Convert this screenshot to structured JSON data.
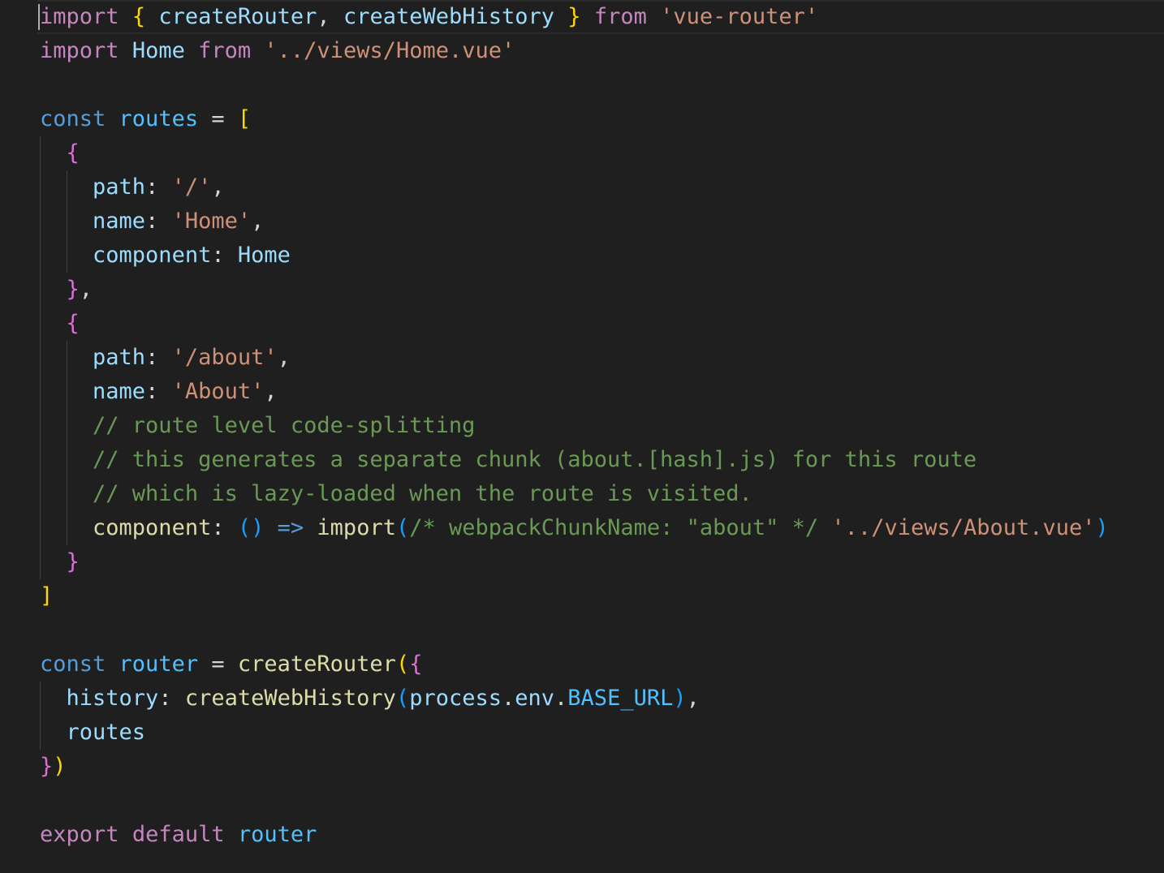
{
  "editor": {
    "language": "javascript",
    "theme_colors": {
      "background": "#1f1f1f",
      "keyword_control": "#c586c0",
      "keyword_storage": "#569cd6",
      "variable": "#9cdcfe",
      "constant": "#4fc1ff",
      "function": "#dcdcaa",
      "string": "#ce9178",
      "comment": "#6a9955",
      "punctuation": "#d4d4d4",
      "bracket_level_1": "#ffd700",
      "bracket_level_2": "#da70d6",
      "bracket_level_3": "#179fff"
    },
    "lines": [
      {
        "tokens": [
          {
            "t": "import",
            "c": "kw"
          },
          {
            "t": " ",
            "c": "pun"
          },
          {
            "t": "{",
            "c": "b1"
          },
          {
            "t": " ",
            "c": "pun"
          },
          {
            "t": "createRouter",
            "c": "var"
          },
          {
            "t": ", ",
            "c": "pun"
          },
          {
            "t": "createWebHistory",
            "c": "var"
          },
          {
            "t": " ",
            "c": "pun"
          },
          {
            "t": "}",
            "c": "b1"
          },
          {
            "t": " ",
            "c": "pun"
          },
          {
            "t": "from",
            "c": "kw"
          },
          {
            "t": " ",
            "c": "pun"
          },
          {
            "t": "'vue-router'",
            "c": "str"
          }
        ]
      },
      {
        "tokens": [
          {
            "t": "import",
            "c": "kw"
          },
          {
            "t": " ",
            "c": "pun"
          },
          {
            "t": "Home",
            "c": "var"
          },
          {
            "t": " ",
            "c": "pun"
          },
          {
            "t": "from",
            "c": "kw"
          },
          {
            "t": " ",
            "c": "pun"
          },
          {
            "t": "'../views/Home.vue'",
            "c": "str"
          }
        ]
      },
      {
        "tokens": []
      },
      {
        "tokens": [
          {
            "t": "const",
            "c": "kw2"
          },
          {
            "t": " ",
            "c": "pun"
          },
          {
            "t": "routes",
            "c": "const"
          },
          {
            "t": " = ",
            "c": "pun"
          },
          {
            "t": "[",
            "c": "b1"
          }
        ]
      },
      {
        "tokens": [
          {
            "t": "  ",
            "c": "pun"
          },
          {
            "t": "{",
            "c": "b2"
          }
        ]
      },
      {
        "tokens": [
          {
            "t": "    ",
            "c": "pun"
          },
          {
            "t": "path",
            "c": "var"
          },
          {
            "t": ": ",
            "c": "pun"
          },
          {
            "t": "'/'",
            "c": "str"
          },
          {
            "t": ",",
            "c": "pun"
          }
        ]
      },
      {
        "tokens": [
          {
            "t": "    ",
            "c": "pun"
          },
          {
            "t": "name",
            "c": "var"
          },
          {
            "t": ": ",
            "c": "pun"
          },
          {
            "t": "'Home'",
            "c": "str"
          },
          {
            "t": ",",
            "c": "pun"
          }
        ]
      },
      {
        "tokens": [
          {
            "t": "    ",
            "c": "pun"
          },
          {
            "t": "component",
            "c": "var"
          },
          {
            "t": ": ",
            "c": "pun"
          },
          {
            "t": "Home",
            "c": "var"
          }
        ]
      },
      {
        "tokens": [
          {
            "t": "  ",
            "c": "pun"
          },
          {
            "t": "}",
            "c": "b2"
          },
          {
            "t": ",",
            "c": "pun"
          }
        ]
      },
      {
        "tokens": [
          {
            "t": "  ",
            "c": "pun"
          },
          {
            "t": "{",
            "c": "b2"
          }
        ]
      },
      {
        "tokens": [
          {
            "t": "    ",
            "c": "pun"
          },
          {
            "t": "path",
            "c": "var"
          },
          {
            "t": ": ",
            "c": "pun"
          },
          {
            "t": "'/about'",
            "c": "str"
          },
          {
            "t": ",",
            "c": "pun"
          }
        ]
      },
      {
        "tokens": [
          {
            "t": "    ",
            "c": "pun"
          },
          {
            "t": "name",
            "c": "var"
          },
          {
            "t": ": ",
            "c": "pun"
          },
          {
            "t": "'About'",
            "c": "str"
          },
          {
            "t": ",",
            "c": "pun"
          }
        ]
      },
      {
        "tokens": [
          {
            "t": "    ",
            "c": "pun"
          },
          {
            "t": "// route level code-splitting",
            "c": "cmt"
          }
        ]
      },
      {
        "tokens": [
          {
            "t": "    ",
            "c": "pun"
          },
          {
            "t": "// this generates a separate chunk (about.[hash].js) for this route",
            "c": "cmt"
          }
        ]
      },
      {
        "tokens": [
          {
            "t": "    ",
            "c": "pun"
          },
          {
            "t": "// which is lazy-loaded when the route is visited.",
            "c": "cmt"
          }
        ]
      },
      {
        "tokens": [
          {
            "t": "    ",
            "c": "pun"
          },
          {
            "t": "component",
            "c": "fn"
          },
          {
            "t": ": ",
            "c": "pun"
          },
          {
            "t": "()",
            "c": "b3"
          },
          {
            "t": " ",
            "c": "pun"
          },
          {
            "t": "=>",
            "c": "kw2"
          },
          {
            "t": " ",
            "c": "pun"
          },
          {
            "t": "import",
            "c": "fn"
          },
          {
            "t": "(",
            "c": "b3"
          },
          {
            "t": "/* webpackChunkName: \"about\" */",
            "c": "cmt"
          },
          {
            "t": " ",
            "c": "pun"
          },
          {
            "t": "'../views/About.vue'",
            "c": "str"
          },
          {
            "t": ")",
            "c": "b3"
          }
        ]
      },
      {
        "tokens": [
          {
            "t": "  ",
            "c": "pun"
          },
          {
            "t": "}",
            "c": "b2"
          }
        ]
      },
      {
        "tokens": [
          {
            "t": "]",
            "c": "b1"
          }
        ]
      },
      {
        "tokens": []
      },
      {
        "tokens": [
          {
            "t": "const",
            "c": "kw2"
          },
          {
            "t": " ",
            "c": "pun"
          },
          {
            "t": "router",
            "c": "const"
          },
          {
            "t": " = ",
            "c": "pun"
          },
          {
            "t": "createRouter",
            "c": "fn"
          },
          {
            "t": "(",
            "c": "b1"
          },
          {
            "t": "{",
            "c": "b2"
          }
        ]
      },
      {
        "tokens": [
          {
            "t": "  ",
            "c": "pun"
          },
          {
            "t": "history",
            "c": "var"
          },
          {
            "t": ": ",
            "c": "pun"
          },
          {
            "t": "createWebHistory",
            "c": "fn"
          },
          {
            "t": "(",
            "c": "b3"
          },
          {
            "t": "process",
            "c": "var"
          },
          {
            "t": ".",
            "c": "pun"
          },
          {
            "t": "env",
            "c": "var"
          },
          {
            "t": ".",
            "c": "pun"
          },
          {
            "t": "BASE_URL",
            "c": "const"
          },
          {
            "t": ")",
            "c": "b3"
          },
          {
            "t": ",",
            "c": "pun"
          }
        ]
      },
      {
        "tokens": [
          {
            "t": "  ",
            "c": "pun"
          },
          {
            "t": "routes",
            "c": "var"
          }
        ]
      },
      {
        "tokens": [
          {
            "t": "}",
            "c": "b2"
          },
          {
            "t": ")",
            "c": "b1"
          }
        ]
      },
      {
        "tokens": []
      },
      {
        "tokens": [
          {
            "t": "export",
            "c": "kw"
          },
          {
            "t": " ",
            "c": "pun"
          },
          {
            "t": "default",
            "c": "kw"
          },
          {
            "t": " ",
            "c": "pun"
          },
          {
            "t": "router",
            "c": "const"
          }
        ]
      }
    ]
  }
}
